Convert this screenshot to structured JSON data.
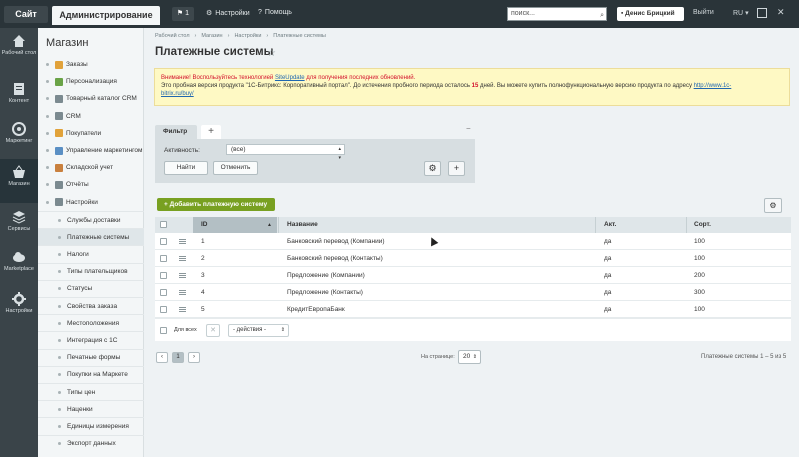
{
  "topbar": {
    "site": "Сайт",
    "admin": "Администрирование",
    "notif_count": "1",
    "settings": "Настройки",
    "help": "Помощь",
    "search_value": "поиск...",
    "user": "Денис Брицкий",
    "exit": "Выйти",
    "lang": "RU"
  },
  "leftnav": [
    {
      "label": "Рабочий стол",
      "icon": "home-icon"
    },
    {
      "label": "Контент",
      "icon": "document-icon"
    },
    {
      "label": "Маркетинг",
      "icon": "target-icon"
    },
    {
      "label": "Магазин",
      "icon": "basket-icon"
    },
    {
      "label": "Сервисы",
      "icon": "layers-icon"
    },
    {
      "label": "Marketplace",
      "icon": "cloud-icon"
    },
    {
      "label": "Настройки",
      "icon": "gear-icon"
    }
  ],
  "menu": {
    "title": "Магазин",
    "items": [
      {
        "label": "Заказы",
        "icon": "cart-icon",
        "color": "#e1a23a"
      },
      {
        "label": "Персонализация",
        "icon": "person-icon",
        "color": "#6aa347"
      },
      {
        "label": "Товарный каталог CRM",
        "icon": "catalog-icon",
        "color": "#7b8a90"
      },
      {
        "label": "CRM",
        "icon": "crm-icon",
        "color": "#7b8a90"
      },
      {
        "label": "Покупатели",
        "icon": "users-icon",
        "color": "#e1a23a"
      },
      {
        "label": "Управление маркетингом",
        "icon": "percent-icon",
        "color": "#5a8fc4"
      },
      {
        "label": "Складской учет",
        "icon": "warehouse-icon",
        "color": "#c9803e"
      },
      {
        "label": "Отчёты",
        "icon": "report-icon",
        "color": "#7b8a90"
      },
      {
        "label": "Настройки",
        "icon": "settings-icon",
        "color": "#7b8a90"
      }
    ],
    "subitems": [
      "Службы доставки",
      "Платежные системы",
      "Налоги",
      "Типы плательщиков",
      "Статусы",
      "Свойства заказа",
      "Местоположения",
      "Интеграция с 1С",
      "Печатные формы",
      "Покупки на Маркете",
      "Типы цен",
      "Наценки",
      "Единицы измерения",
      "Экспорт данных"
    ]
  },
  "breadcrumbs": [
    "Рабочий стол",
    "Магазин",
    "Настройки",
    "Платежные системы"
  ],
  "page_title": "Платежные системы",
  "alert": {
    "line1_red": "Внимание! Воспользуйтесь технологией ",
    "line1_link": "SiteUpdate",
    "line1_tail": " для получения последних обновлений.",
    "line2_a": "Это пробная версия продукта \"1С-Битрикс: Корпоративный портал\". До истечения пробного периода осталось ",
    "line2_days": "15",
    "line2_b": " дней. Вы можете купить полнофункциональную версию продукта по адресу ",
    "line2_link_a": "http://www.1c-",
    "line2_link_b": "bitrix.ru/buy/"
  },
  "filter": {
    "tab": "Фильтр",
    "activity_label": "Активность:",
    "activity_value": "(все)",
    "find": "Найти",
    "cancel": "Отменить"
  },
  "add_button": "Добавить платежную систему",
  "grid": {
    "columns": [
      "ID",
      "Название",
      "Акт.",
      "Сорт."
    ],
    "rows": [
      {
        "id": "1",
        "name": "Банковский перевод (Компании)",
        "active": "да",
        "sort": "100"
      },
      {
        "id": "2",
        "name": "Банковский перевод (Контакты)",
        "active": "да",
        "sort": "100"
      },
      {
        "id": "3",
        "name": "Предложение (Компании)",
        "active": "да",
        "sort": "200"
      },
      {
        "id": "4",
        "name": "Предложение (Контакты)",
        "active": "да",
        "sort": "300"
      },
      {
        "id": "5",
        "name": "КредитЕвропаБанк",
        "active": "да",
        "sort": "100"
      }
    ],
    "for_all": "Для всех",
    "actions": "- действия -"
  },
  "pager": {
    "current": "1",
    "per_page_label": "На странице:",
    "per_page": "20",
    "total": "Платежные системы 1 – 5 из 5"
  },
  "colors": {
    "accent_green": "#78a021",
    "topbar": "#2a3439",
    "alert_red": "#d3122c"
  }
}
